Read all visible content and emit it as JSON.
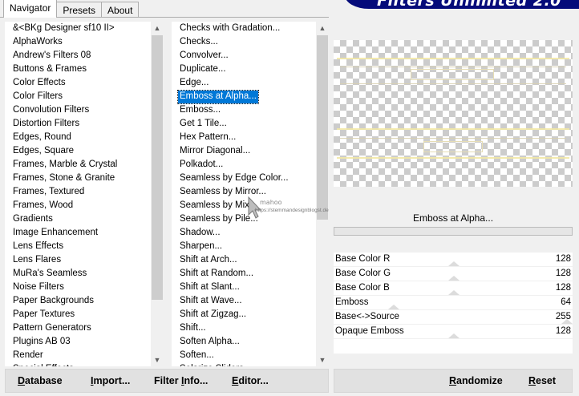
{
  "tabs": [
    {
      "label": "Navigator",
      "active": true
    },
    {
      "label": "Presets",
      "active": false
    },
    {
      "label": "About",
      "active": false
    }
  ],
  "banner": {
    "text": "Filters Unlimited 2.0",
    "color": "#050b7a"
  },
  "categories": {
    "items": [
      "&<BKg Designer sf10 II>",
      "AlphaWorks",
      "Andrew's Filters 08",
      "Buttons & Frames",
      "Color Effects",
      "Color Filters",
      "Convolution Filters",
      "Distortion Filters",
      "Edges, Round",
      "Edges, Square",
      "Frames, Marble & Crystal",
      "Frames, Stone & Granite",
      "Frames, Textured",
      "Frames, Wood",
      "Gradients",
      "Image Enhancement",
      "Lens Effects",
      "Lens Flares",
      "MuRa's Seamless",
      "Noise Filters",
      "Paper Backgrounds",
      "Paper Textures",
      "Pattern Generators",
      "Plugins AB 03",
      "Render",
      "Special Effects"
    ],
    "selected_index": -1
  },
  "filters": {
    "items": [
      "Checks with Gradation...",
      "Checks...",
      "Convolver...",
      "Duplicate...",
      "Edge...",
      "Emboss at Alpha...",
      "Emboss...",
      "Get 1 Tile...",
      "Hex Pattern...",
      "Mirror Diagonal...",
      "Polkadot...",
      "Seamless by Edge Color...",
      "Seamless by Mirror...",
      "Seamless by Mix...",
      "Seamless by Pile...",
      "Shadow...",
      "Sharpen...",
      "Shift at Arch...",
      "Shift at Random...",
      "Shift at Slant...",
      "Shift at Wave...",
      "Shift at Zigzag...",
      "Shift...",
      "Soften Alpha...",
      "Soften...",
      "Solarize Sliders..."
    ],
    "selected_index": 5
  },
  "current_filter": "Emboss at Alpha...",
  "params": [
    {
      "label": "Base Color R",
      "value": "128",
      "level": 0.5
    },
    {
      "label": "Base Color G",
      "value": "128",
      "level": 0.5
    },
    {
      "label": "Base Color B",
      "value": "128",
      "level": 0.5
    },
    {
      "label": "Emboss",
      "value": "64",
      "level": 0.25
    },
    {
      "label": "Base<->Source",
      "value": "255",
      "level": 1.0
    },
    {
      "label": "Opaque Emboss",
      "value": "128",
      "level": 0.5
    }
  ],
  "watermark": {
    "line1": "mahoo",
    "line2": "https://stemmandesignblogst.de"
  },
  "buttons": {
    "database": {
      "accel": "D",
      "rest": "atabase"
    },
    "import": {
      "accel": "I",
      "rest": "mport..."
    },
    "filter_info": {
      "pre": "Filter ",
      "accel": "I",
      "rest": "nfo..."
    },
    "editor": {
      "accel": "E",
      "rest": "ditor..."
    },
    "randomize": {
      "accel": "R",
      "rest": "andomize"
    },
    "reset": {
      "accel": "R",
      "rest": "eset"
    }
  },
  "colors": {
    "selection": "#0078d7",
    "preview_accent": "#f2e8a6"
  },
  "icons": {
    "scroll_up": "up-arrow-icon",
    "scroll_down": "down-arrow-icon"
  }
}
